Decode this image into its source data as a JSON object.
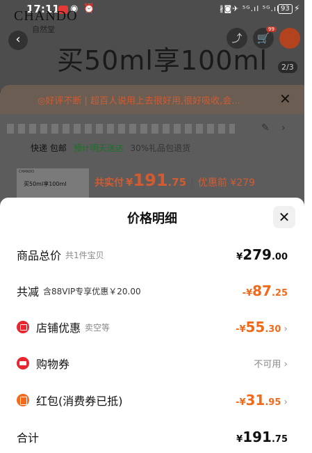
{
  "status_bar": {
    "time": "17:11",
    "right_indicators": "∦◙✈ ⁵ᴳ.ıl ⁵ᴳ.ıl",
    "battery": "93",
    "charging": "⚡"
  },
  "background": {
    "brand_logo": "CHANDO",
    "brand_sub": "自然堂",
    "hero_text": "买50ml享100ml",
    "image_index": "2/3",
    "review_text": "好评不断 | 超百人说用上去很好用,很好吸收,会...",
    "shipping": {
      "free": "快递 包邮",
      "green": "预计明天送达",
      "rest": "30%礼品包退货"
    },
    "buy_bar": {
      "thumb_brand": "CHANDO",
      "thumb_text": "买50ml享100ml",
      "pay_label": "共实付",
      "pay_yen": "¥",
      "pay_int": "191",
      "pay_dec": ".75",
      "separator": "|",
      "pre_discount": "优惠前 ¥279"
    }
  },
  "sheet": {
    "title": "价格明细",
    "close_glyph": "✕",
    "rows": [
      {
        "label": "商品总价",
        "sub": "共1件宝贝",
        "yen": "¥",
        "int": "279",
        "dec": ".00",
        "tone": "dark",
        "chevron": false
      },
      {
        "label": "共减",
        "sub": "含88VIP专享优惠￥20.00",
        "yen": "-¥",
        "int": "87",
        "dec": ".25",
        "tone": "orange",
        "chevron": false
      },
      {
        "label": "店铺优惠",
        "sub": "卖空等",
        "icon": "store-icon",
        "yen": "-¥",
        "int": "55",
        "dec": ".30",
        "tone": "orange",
        "chevron": true
      },
      {
        "label": "购物券",
        "icon": "ticket-icon",
        "status": "不可用",
        "chevron": true
      },
      {
        "label": "红包(消费券已抵)",
        "icon": "red-packet-icon",
        "yen": "-¥",
        "int": "31",
        "dec": ".95",
        "tone": "orange",
        "chevron": true
      },
      {
        "label": "合计",
        "yen": "¥",
        "int": "191",
        "dec": ".75",
        "tone": "dark",
        "chevron": false
      }
    ],
    "chevron_glyph": "›"
  },
  "colors": {
    "accent_orange": "#f06a1a",
    "icon_red": "#e8262f",
    "overlay": "#3a3a3a"
  }
}
